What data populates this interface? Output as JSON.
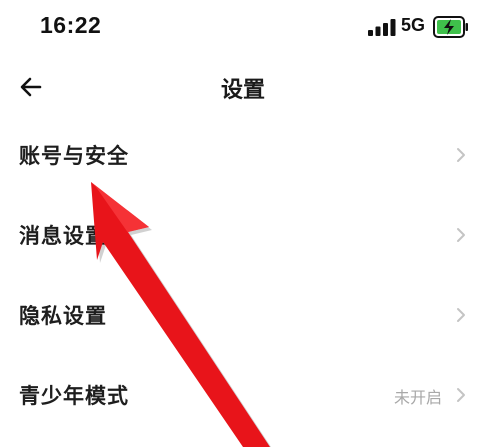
{
  "status_bar": {
    "time": "16:22",
    "network": "5G"
  },
  "nav": {
    "title": "设置"
  },
  "settings": {
    "items": [
      {
        "label": "账号与安全",
        "value": ""
      },
      {
        "label": "消息设置",
        "value": ""
      },
      {
        "label": "隐私设置",
        "value": ""
      },
      {
        "label": "青少年模式",
        "value": "未开启"
      }
    ]
  },
  "colors": {
    "annotation_arrow": "#e8141a",
    "battery_charging": "#3fc14b",
    "secondary_text": "#a8a8a8",
    "chevron": "#c4c4c4"
  }
}
